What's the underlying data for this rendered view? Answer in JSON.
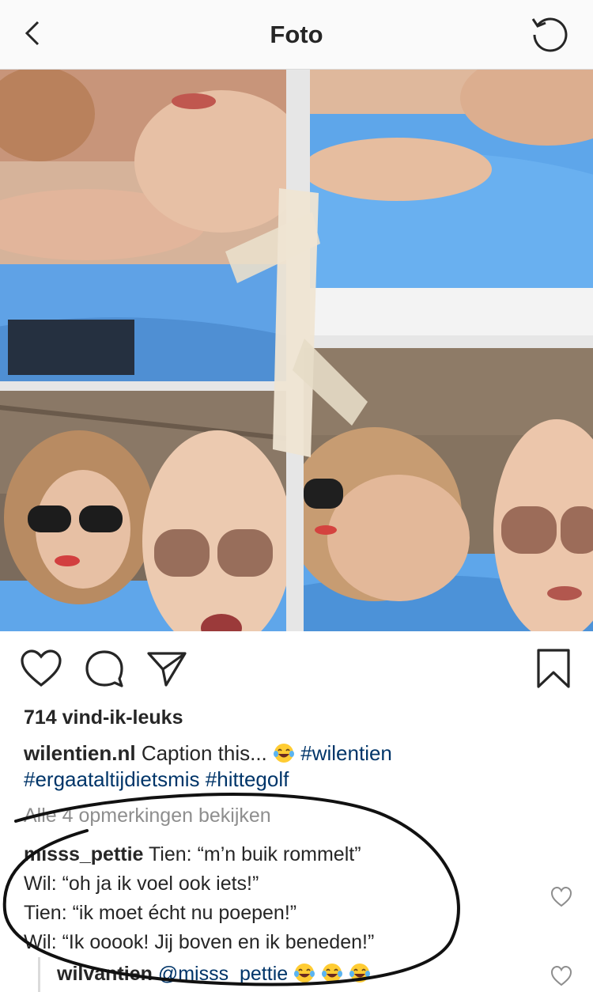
{
  "header": {
    "title": "Foto",
    "back_icon": "chevron-left-icon",
    "refresh_icon": "refresh-icon"
  },
  "post": {
    "likes_text": "714 vind-ik-leuks",
    "caption": {
      "username": "wilentien.nl",
      "text": "Caption this...",
      "emoji": "face-with-tears-of-joy",
      "tags": [
        "#wilentien",
        "#ergaataltijdietsmis",
        "#hittegolf"
      ]
    },
    "view_all_comments": "Alle 4 opmerkingen bekijken",
    "comment": {
      "username": "misss_pettie",
      "lines": [
        "Tien: “m’n buik rommelt”",
        "Wil: “oh ja ik voel ook iets!”",
        "Tien: “ik moet écht nu poepen!”",
        "Wil: “Ik ooook! Jij boven en ik beneden!”"
      ]
    },
    "reply": {
      "username": "wilvantien",
      "mention": "@misss_pettie",
      "emoji_count": 3
    }
  },
  "actions": {
    "like_icon": "heart-outline-icon",
    "comment_icon": "comment-bubble-icon",
    "share_icon": "paper-plane-icon",
    "save_icon": "bookmark-icon"
  },
  "colors": {
    "header_bg": "#fafafa",
    "text": "#262626",
    "muted": "#8e8e8e",
    "link": "#003569",
    "pool_blue": "#5aa0e0"
  }
}
